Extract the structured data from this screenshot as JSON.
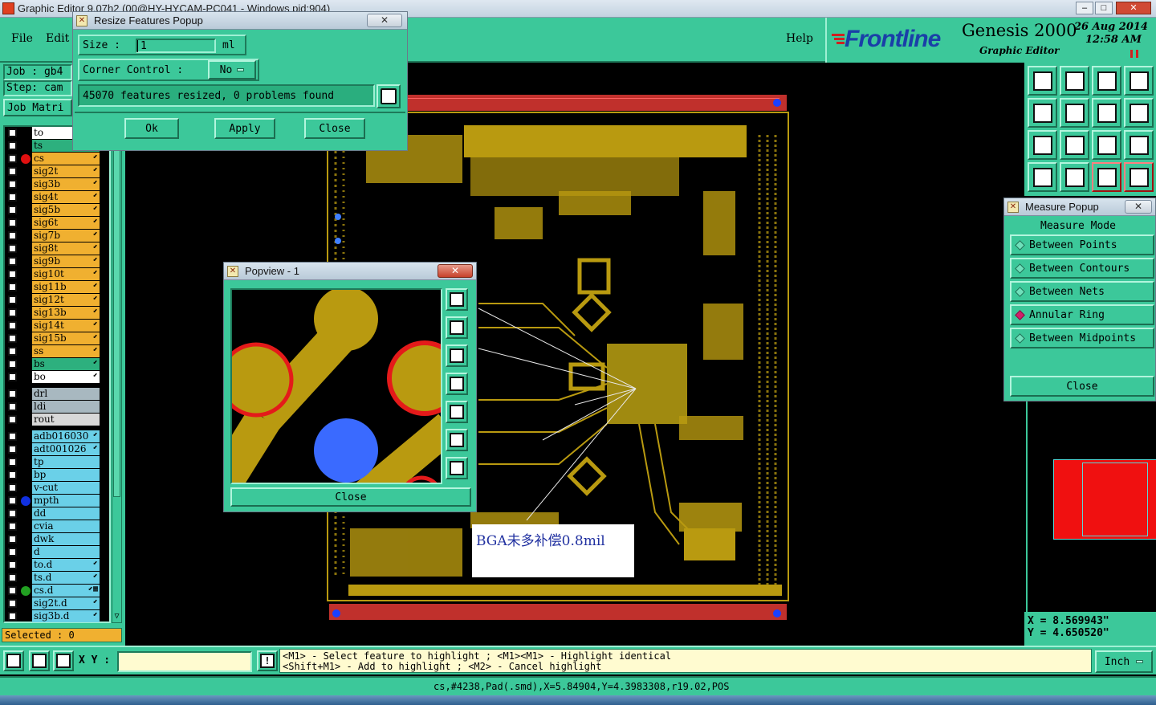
{
  "window": {
    "title": "Graphic Editor 9.07h2 (00@HY-HYCAM-PC041 - Windows pid:904)"
  },
  "menu": {
    "file": "File",
    "edit": "Edit",
    "help": "Help"
  },
  "brand": {
    "logo": "Frontline",
    "product": "Genesis 2000",
    "subtitle": "Graphic Editor",
    "date": "26 Aug 2014",
    "time": "12:58 AM"
  },
  "job": {
    "job_label": "Job : gb4",
    "step_label": "Step: cam",
    "matrix_button": "Job Matri"
  },
  "layers": {
    "board": [
      {
        "name": "to",
        "color": "#ffffff",
        "edit": ""
      },
      {
        "name": "ts",
        "color": "#2db07e",
        "edit": ""
      },
      {
        "name": "cs",
        "color": "#f0b030",
        "edit": "⬋"
      },
      {
        "name": "sig2t",
        "color": "#f0b030",
        "edit": "⬋"
      },
      {
        "name": "sig3b",
        "color": "#f0b030",
        "edit": "⬋"
      },
      {
        "name": "sig4t",
        "color": "#f0b030",
        "edit": "⬋"
      },
      {
        "name": "sig5b",
        "color": "#f0b030",
        "edit": "⬋"
      },
      {
        "name": "sig6t",
        "color": "#f0b030",
        "edit": "⬋"
      },
      {
        "name": "sig7b",
        "color": "#f0b030",
        "edit": "⬋"
      },
      {
        "name": "sig8t",
        "color": "#f0b030",
        "edit": "⬋"
      },
      {
        "name": "sig9b",
        "color": "#f0b030",
        "edit": "⬋"
      },
      {
        "name": "sig10t",
        "color": "#f0b030",
        "edit": "⬋"
      },
      {
        "name": "sig11b",
        "color": "#f0b030",
        "edit": "⬋"
      },
      {
        "name": "sig12t",
        "color": "#f0b030",
        "edit": "⬋"
      },
      {
        "name": "sig13b",
        "color": "#f0b030",
        "edit": "⬋"
      },
      {
        "name": "sig14t",
        "color": "#f0b030",
        "edit": "⬋"
      },
      {
        "name": "sig15b",
        "color": "#f0b030",
        "edit": "⬋"
      },
      {
        "name": "ss",
        "color": "#f0b030",
        "edit": "⬋"
      },
      {
        "name": "bs",
        "color": "#2db07e",
        "edit": "⬋"
      },
      {
        "name": "bo",
        "color": "#ffffff",
        "edit": "⬋"
      }
    ],
    "drill": [
      {
        "name": "drl",
        "color": "#a8b8c0",
        "edit": ""
      },
      {
        "name": "ldi",
        "color": "#a8b8c0",
        "edit": ""
      },
      {
        "name": "rout",
        "color": "#d8d8d8",
        "edit": ""
      }
    ],
    "misc": [
      {
        "name": "adb016030",
        "color": "#6ad0e8",
        "edit": "⬋"
      },
      {
        "name": "adt001026",
        "color": "#6ad0e8",
        "edit": "⬋"
      },
      {
        "name": "tp",
        "color": "#6ad0e8",
        "edit": ""
      },
      {
        "name": "bp",
        "color": "#6ad0e8",
        "edit": ""
      },
      {
        "name": "v-cut",
        "color": "#6ad0e8",
        "edit": ""
      },
      {
        "name": "mpth",
        "color": "#6ad0e8",
        "edit": ""
      },
      {
        "name": "dd",
        "color": "#6ad0e8",
        "edit": ""
      },
      {
        "name": "cvia",
        "color": "#6ad0e8",
        "edit": ""
      },
      {
        "name": "dwk",
        "color": "#6ad0e8",
        "edit": ""
      },
      {
        "name": "d",
        "color": "#6ad0e8",
        "edit": ""
      },
      {
        "name": "to.d",
        "color": "#6ad0e8",
        "edit": "⬋"
      },
      {
        "name": "ts.d",
        "color": "#6ad0e8",
        "edit": "⬋"
      },
      {
        "name": "cs.d",
        "color": "#6ad0e8",
        "edit": "⬋▦"
      },
      {
        "name": "sig2t.d",
        "color": "#6ad0e8",
        "edit": "⬋"
      },
      {
        "name": "sig3b.d",
        "color": "#6ad0e8",
        "edit": "⬋"
      }
    ],
    "selected": "Selected : 0"
  },
  "resize_popup": {
    "title": "Resize Features Popup",
    "size_label": "Size :",
    "size_value": "1",
    "size_unit": "ml",
    "corner_label": "Corner Control :",
    "corner_value": "No",
    "status": "45070 features resized, 0 problems found",
    "ok": "Ok",
    "apply": "Apply",
    "close": "Close"
  },
  "popview": {
    "title": "Popview - 1",
    "close": "Close"
  },
  "measure_popup": {
    "title": "Measure Popup",
    "mode_header": "Measure Mode",
    "options": [
      "Between Points",
      "Between Contours",
      "Between Nets",
      "Annular Ring",
      "Between Midpoints"
    ],
    "selected_index": 3,
    "close": "Close"
  },
  "annotation": {
    "text": "BGA未多补偿0.8mil"
  },
  "coords": {
    "x": "X = 8.569943\"",
    "y": "Y = 4.650520\""
  },
  "bottom": {
    "xy_label": "X Y :",
    "hint_line1": "<M1> - Select feature to highlight ; <M1><M1> - Highlight identical",
    "hint_line2": "<Shift+M1> - Add to highlight ; <M2> - Cancel highlight",
    "unit": "Inch",
    "status": "cs,#4238,Pad(.smd),X=5.84904,Y=4.3983308,r19.02,POS"
  },
  "colors": {
    "teal": "#3cc89a",
    "copper": "#b99a10",
    "board_bg": "#000000",
    "soldermask": "#e0202a",
    "drill_blue": "#3a6aff"
  }
}
